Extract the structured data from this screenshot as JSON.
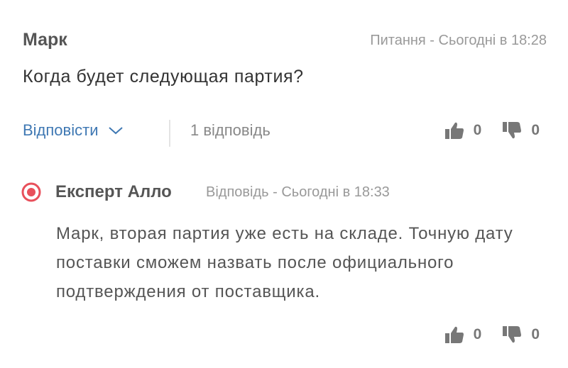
{
  "question": {
    "author": "Марк",
    "meta": "Питання - Сьогодні в 18:28",
    "text": "Когда будет следующая партия?",
    "reply_label": "Відповісти",
    "replies_count": "1 відповідь",
    "likes": "0",
    "dislikes": "0"
  },
  "answer": {
    "author": "Експерт Алло",
    "meta": "Відповідь - Сьогодні в 18:33",
    "text": "Марк, вторая партия уже есть на складе. Точную дату поставки сможем назвать после официального подтверждения от поставщика.",
    "likes": "0",
    "dislikes": "0"
  },
  "colors": {
    "accent_link": "#3f78b3",
    "expert_icon": "#e8505b",
    "muted_text": "#999999"
  },
  "icons": [
    "chevron-down-icon",
    "thumbs-up-icon",
    "thumbs-down-icon",
    "expert-badge-icon"
  ]
}
